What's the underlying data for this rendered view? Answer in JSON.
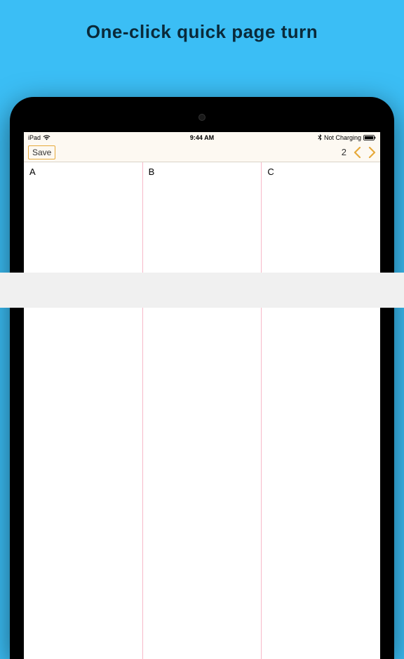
{
  "promo": {
    "headline": "One-click quick page turn"
  },
  "status": {
    "carrier": "iPad",
    "time": "9:44 AM",
    "charging": "Not Charging"
  },
  "toolbar": {
    "save_label": "Save",
    "page_number": "2"
  },
  "columns": {
    "a": "A",
    "b": "B",
    "c": "C"
  },
  "colors": {
    "background": "#3bbef5",
    "accent": "#e6a93a",
    "divider": "#f7b8c8"
  }
}
